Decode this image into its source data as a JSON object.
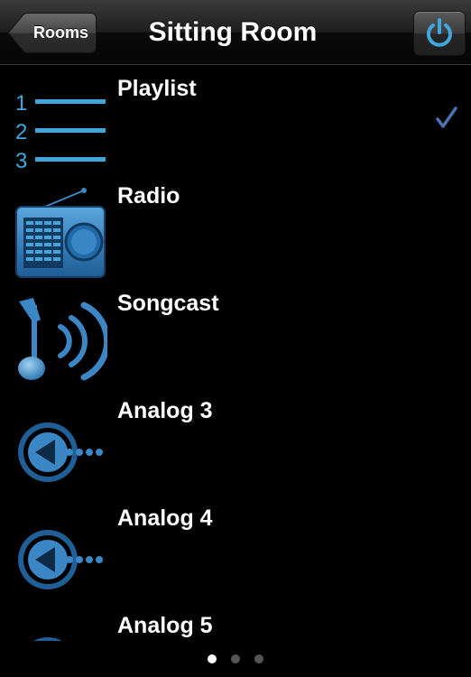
{
  "navbar": {
    "back_label": "Rooms",
    "title": "Sitting Room",
    "power_icon": "power-icon"
  },
  "sources": [
    {
      "label": "Playlist",
      "icon": "playlist-icon",
      "selected": true
    },
    {
      "label": "Radio",
      "icon": "radio-icon",
      "selected": false
    },
    {
      "label": "Songcast",
      "icon": "songcast-icon",
      "selected": false
    },
    {
      "label": "Analog 3",
      "icon": "analog-input-icon",
      "selected": false
    },
    {
      "label": "Analog 4",
      "icon": "analog-input-icon",
      "selected": false
    },
    {
      "label": "Analog 5",
      "icon": "analog-input-icon",
      "selected": false
    }
  ],
  "pager": {
    "pages": 3,
    "current": 1
  },
  "colors": {
    "accent_blue": "#3fa6de",
    "icon_blue": "#3b86c4",
    "checkmark": "#4a72b0",
    "background": "#000000"
  }
}
